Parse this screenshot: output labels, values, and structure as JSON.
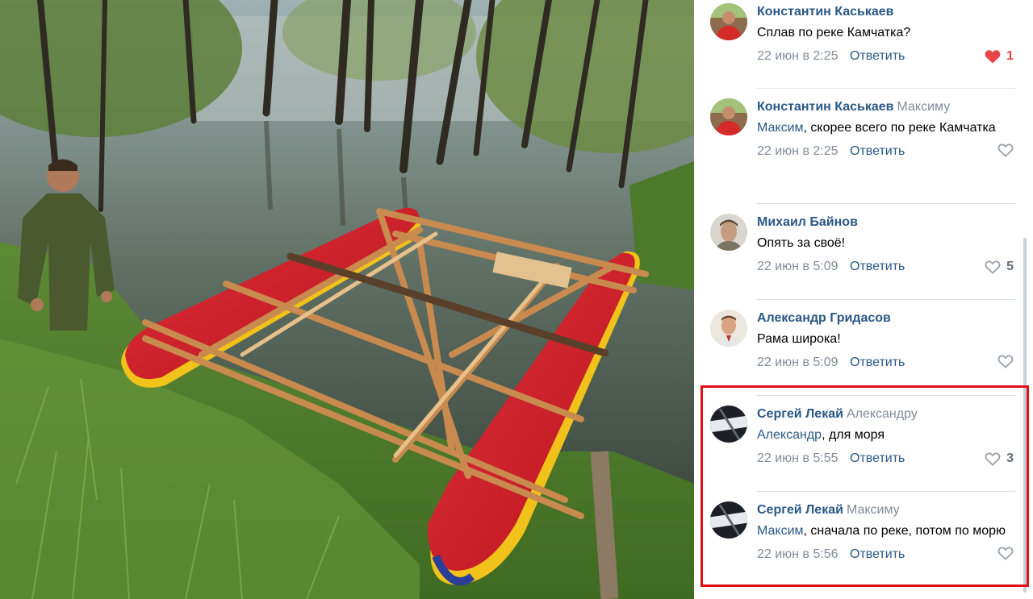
{
  "photo": {
    "icon": "catamaran-photo"
  },
  "comments": [
    {
      "author": "Константин Каськаев",
      "reply_to": "",
      "addressee": "",
      "text": "Сплав по реке Камчатка?",
      "date": "22 июн в 2:25",
      "reply_label": "Ответить",
      "likes": "1",
      "liked": true
    },
    {
      "author": "Константин Каськаев",
      "reply_to": "Максиму",
      "addressee": "Максим",
      "text": ", скорее всего по реке Камчатка",
      "date": "22 июн в 2:25",
      "reply_label": "Ответить",
      "likes": "",
      "liked": false
    },
    {
      "author": "Михаил Байнов",
      "reply_to": "",
      "addressee": "",
      "text": "Опять за своё!",
      "date": "22 июн в 5:09",
      "reply_label": "Ответить",
      "likes": "5",
      "liked": false
    },
    {
      "author": "Александр Гридасов",
      "reply_to": "",
      "addressee": "",
      "text": "Рама широка!",
      "date": "22 июн в 5:09",
      "reply_label": "Ответить",
      "likes": "",
      "liked": false
    },
    {
      "author": "Сергей Лекай",
      "reply_to": "Александру",
      "addressee": "Александр",
      "text": ", для моря",
      "date": "22 июн в 5:55",
      "reply_label": "Ответить",
      "likes": "3",
      "liked": false
    },
    {
      "author": "Сергей Лекай",
      "reply_to": "Максиму",
      "addressee": "Максим",
      "text": ", сначала по реке, потом по морю",
      "date": "22 июн в 5:56",
      "reply_label": "Ответить",
      "likes": "",
      "liked": false
    }
  ],
  "colors": {
    "link": "#2a5885",
    "muted": "#818c99",
    "like_active": "#e64646",
    "highlight": "#e30f16"
  }
}
